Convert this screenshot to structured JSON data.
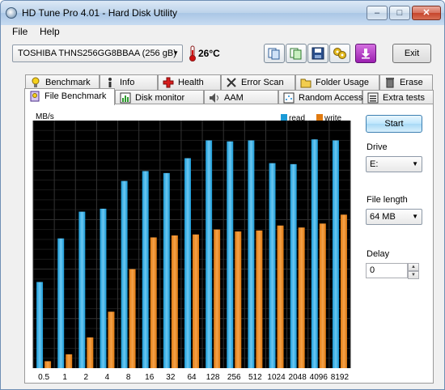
{
  "window": {
    "title": "HD Tune Pro 4.01 - Hard Disk Utility"
  },
  "menu": {
    "items": [
      "File",
      "Help"
    ]
  },
  "toolbar": {
    "drive": "TOSHIBA THNS256GG8BBAA   (256 gB)",
    "temperature": "26°C",
    "exit_label": "Exit",
    "icons": [
      "copy-info-icon",
      "copy-screenshot-icon",
      "save-icon",
      "options-icon",
      "download-icon"
    ]
  },
  "tabs": {
    "row1": [
      {
        "label": "Benchmark",
        "icon": "lightbulb-icon"
      },
      {
        "label": "Info",
        "icon": "info-icon"
      },
      {
        "label": "Health",
        "icon": "health-cross-icon"
      },
      {
        "label": "Error Scan",
        "icon": "error-scan-icon"
      },
      {
        "label": "Folder Usage",
        "icon": "folder-icon"
      },
      {
        "label": "Erase",
        "icon": "trash-icon"
      }
    ],
    "row2": [
      {
        "label": "File Benchmark",
        "icon": "file-benchmark-icon",
        "active": true
      },
      {
        "label": "Disk monitor",
        "icon": "disk-monitor-icon"
      },
      {
        "label": "AAM",
        "icon": "speaker-icon"
      },
      {
        "label": "Random Access",
        "icon": "random-access-icon"
      },
      {
        "label": "Extra tests",
        "icon": "extra-tests-icon"
      }
    ]
  },
  "controls": {
    "start_label": "Start",
    "drive_label": "Drive",
    "drive_value": "E:",
    "file_length_label": "File length",
    "file_length_value": "64 MB",
    "delay_label": "Delay",
    "delay_value": "0"
  },
  "chart_data": {
    "type": "bar",
    "ylabel": "MB/s",
    "ylim": [
      0,
      250
    ],
    "yticks": [
      50,
      100,
      150,
      200
    ],
    "categories": [
      "0.5",
      "1",
      "2",
      "4",
      "8",
      "16",
      "32",
      "64",
      "128",
      "256",
      "512",
      "1024",
      "2048",
      "4096",
      "8192"
    ],
    "series": [
      {
        "name": "read",
        "color": "#1a9ad6",
        "values": [
          87,
          131,
          158,
          161,
          189,
          199,
          197,
          212,
          230,
          229,
          230,
          207,
          206,
          231,
          230
        ]
      },
      {
        "name": "write",
        "color": "#e07a10",
        "values": [
          7,
          14,
          31,
          57,
          100,
          132,
          134,
          135,
          140,
          138,
          139,
          144,
          142,
          146,
          155
        ]
      }
    ],
    "legend": "top-right",
    "grid": true
  }
}
